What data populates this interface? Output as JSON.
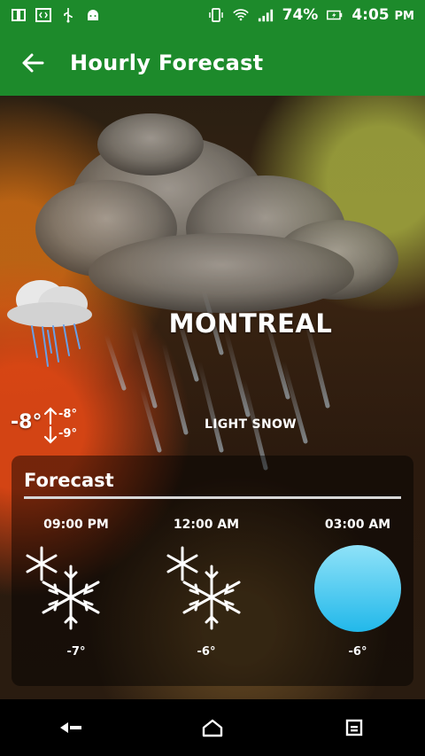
{
  "status_bar": {
    "battery_percent": "74%",
    "time": "4:05",
    "time_suffix": "PM",
    "icons": [
      "screen-icon",
      "code-icon",
      "usb-icon",
      "android-icon",
      "vibrate-icon",
      "wifi-icon",
      "signal-icon",
      "battery-icon"
    ]
  },
  "app_bar": {
    "title": "Hourly Forecast",
    "back_icon": "back-arrow-icon"
  },
  "current": {
    "city": "MONTREAL",
    "temp": "-8°",
    "high": "-8°",
    "low": "-9°",
    "condition": "LIGHT SNOW"
  },
  "forecast": {
    "title": "Forecast",
    "hours": [
      {
        "time": "09:00 PM",
        "temp": "-7°",
        "icon": "snowflake-icon"
      },
      {
        "time": "12:00 AM",
        "temp": "-6°",
        "icon": "snowflake-icon"
      },
      {
        "time": "03:00 AM",
        "temp": "-6°",
        "icon": "blue-circle-icon"
      }
    ]
  },
  "nav_bar": {
    "buttons": [
      "back-nav-icon",
      "home-nav-icon",
      "recents-nav-icon"
    ]
  },
  "colors": {
    "app_green": "#1d8a2b",
    "orb_blue": "#39c4ef"
  }
}
